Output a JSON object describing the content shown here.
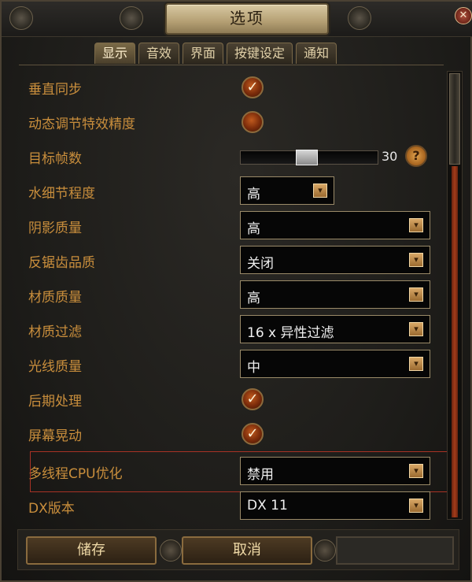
{
  "window": {
    "title": "选项",
    "close_symbol": "✕"
  },
  "tabs": [
    {
      "label": "显示",
      "active": true
    },
    {
      "label": "音效",
      "active": false
    },
    {
      "label": "界面",
      "active": false
    },
    {
      "label": "按键设定",
      "active": false
    },
    {
      "label": "通知",
      "active": false
    }
  ],
  "settings": {
    "vsync": {
      "label": "垂直同步",
      "checked": true
    },
    "dynamic_effects": {
      "label": "动态调节特效精度",
      "checked": false
    },
    "target_fps": {
      "label": "目标帧数",
      "value": "30",
      "slider_fraction": 0.48
    },
    "water_detail": {
      "label": "水细节程度",
      "value": "高"
    },
    "shadow_quality": {
      "label": "阴影质量",
      "value": "高"
    },
    "antialiasing": {
      "label": "反锯齿品质",
      "value": "关闭"
    },
    "texture_quality": {
      "label": "材质质量",
      "value": "高"
    },
    "texture_filter": {
      "label": "材质过滤",
      "value": "16 x 异性过滤"
    },
    "lighting_quality": {
      "label": "光线质量",
      "value": "中"
    },
    "post_processing": {
      "label": "后期处理",
      "checked": true
    },
    "screen_shake": {
      "label": "屏幕晃动",
      "checked": true
    },
    "multithread_cpu": {
      "label": "多线程CPU优化",
      "value": "禁用"
    },
    "dx_version": {
      "label": "DX版本",
      "value": "DX 11"
    }
  },
  "icons": {
    "check": "check-icon",
    "dropdown": "dropdown-arrow-icon",
    "help": "help-icon",
    "help_symbol": "?"
  },
  "buttons": {
    "save": "储存",
    "cancel": "取消"
  },
  "colors": {
    "label": "#c98e3c",
    "highlight_border": "#a83225",
    "title_plate": "#c8b68b"
  }
}
